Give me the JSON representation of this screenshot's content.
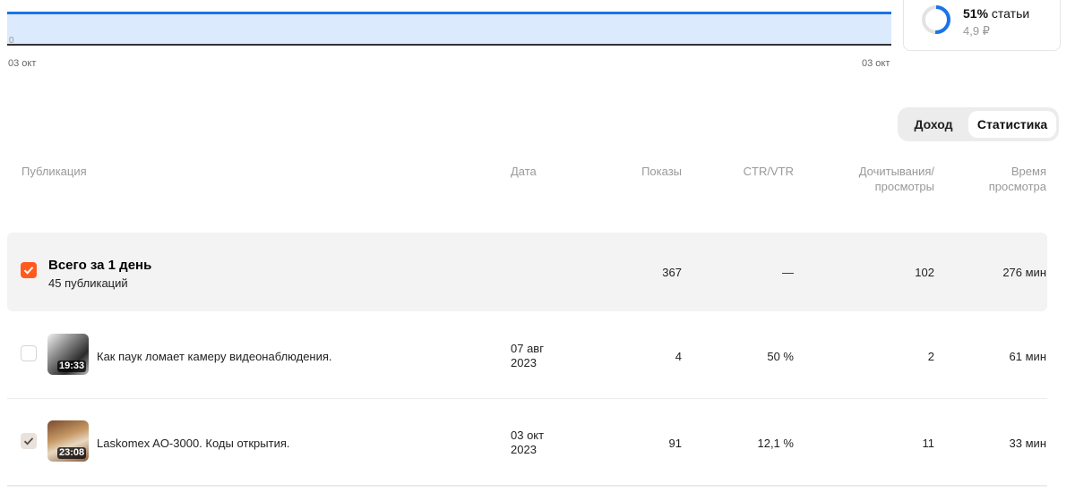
{
  "chart": {
    "zero_label": "0",
    "x_start": "03 окт",
    "x_end": "03 окт"
  },
  "share": {
    "percent": "51%",
    "label": "статьи",
    "amount": "4,9 ₽",
    "fraction": 0.51,
    "ring_color": "#1a73e8"
  },
  "toggle": {
    "income": "Доход",
    "stats": "Статистика",
    "selected": "Статистика"
  },
  "columns": {
    "publication": "Публикация",
    "date": "Дата",
    "impressions": "Показы",
    "ctr": "CTR/VTR",
    "reads_line1": "Дочитывания/",
    "reads_line2": "просмотры",
    "time_line1": "Время",
    "time_line2": "просмотра"
  },
  "total": {
    "title": "Всего за 1 день",
    "subtitle": "45 публикаций",
    "impressions": "367",
    "ctr": "—",
    "reads": "102",
    "time": "276 мин",
    "checked": true
  },
  "rows": [
    {
      "duration": "19:33",
      "title": "Как паук ломает камеру видеонаблюдения.",
      "date_line1": "07 авг",
      "date_line2": "2023",
      "impressions": "4",
      "ctr": "50 %",
      "reads": "2",
      "time": "61 мин",
      "checked": false
    },
    {
      "duration": "23:08",
      "title": "Laskomex AO-3000. Коды открытия.",
      "date_line1": "03 окт",
      "date_line2": "2023",
      "impressions": "91",
      "ctr": "12,1 %",
      "reads": "11",
      "time": "33 мин",
      "checked": true
    }
  ],
  "colors": {
    "accent": "#ff5b1f",
    "chart_line": "#1a73e8",
    "chart_fill": "#dbeafc"
  }
}
